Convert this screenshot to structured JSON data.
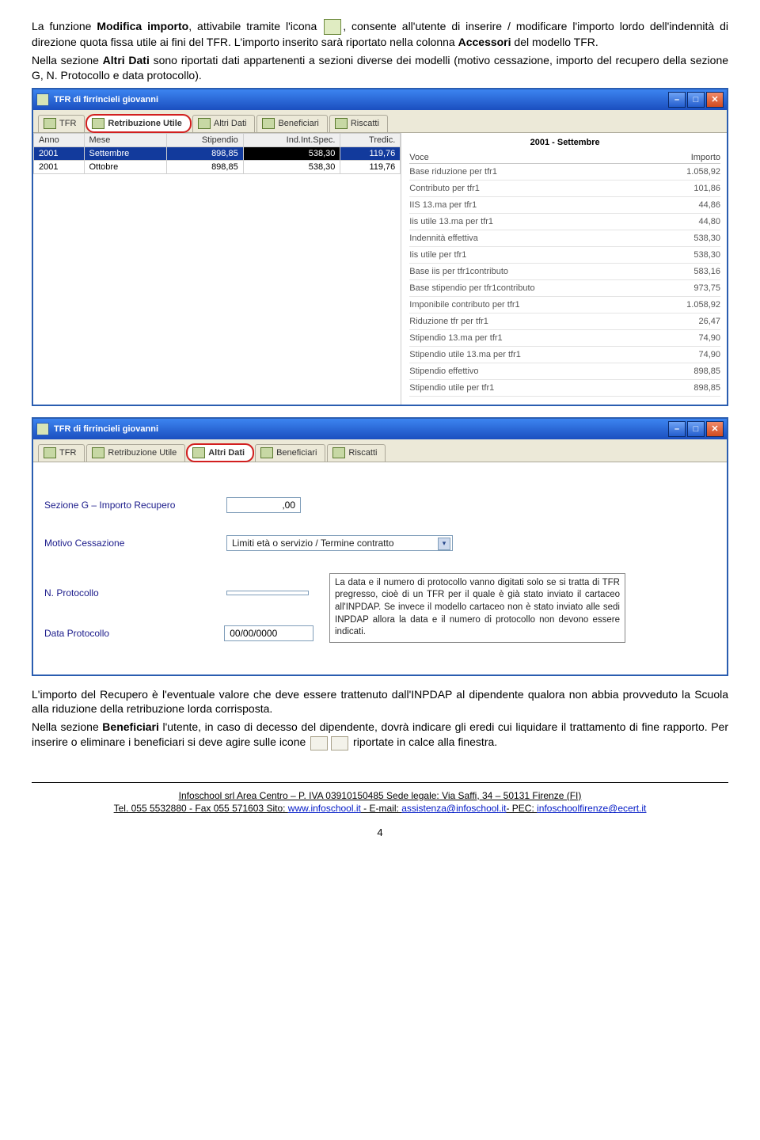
{
  "para": {
    "p1a": "La funzione ",
    "p1b": "Modifica importo",
    "p1c": ", attivabile tramite l'icona ",
    "p1d": ", consente all'utente di inserire / modificare l'importo lordo dell'indennità di direzione quota fissa utile ai fini del TFR. L'importo inserito sarà riportato nella colonna ",
    "p1e": "Accessori",
    "p1f": " del modello TFR.",
    "p2a": "Nella sezione ",
    "p2b": "Altri Dati",
    "p2c": " sono riportati dati appartenenti a sezioni diverse dei modelli (motivo cessazione, importo del recupero della sezione G, N. Protocollo e data protocollo).",
    "p3": "L'importo del Recupero è l'eventuale valore che deve essere trattenuto dall'INPDAP al dipendente qualora non abbia provveduto la Scuola alla riduzione della retribuzione lorda corrisposta.",
    "p4a": "Nella sezione ",
    "p4b": "Beneficiari",
    "p4c": " l'utente, in caso di decesso del dipendente, dovrà indicare gli eredi cui liquidare il trattamento di fine rapporto. Per inserire o eliminare i beneficiari si deve agire sulle icone ",
    "p4d": " riportate in calce alla finestra."
  },
  "win1": {
    "title": "TFR di firrincieli giovanni",
    "tabs": [
      "TFR",
      "Retribuzione Utile",
      "Altri Dati",
      "Beneficiari",
      "Riscatti"
    ],
    "grid": {
      "headers": [
        "Anno",
        "Mese",
        "Stipendio",
        "Ind.Int.Spec.",
        "Tredic."
      ],
      "rows": [
        [
          "2001",
          "Settembre",
          "898,85",
          "538,30",
          "119,76"
        ],
        [
          "2001",
          "Ottobre",
          "898,85",
          "538,30",
          "119,76"
        ]
      ]
    },
    "right": {
      "title": "2001 - Settembre",
      "col1": "Voce",
      "col2": "Importo",
      "items": [
        [
          "Base riduzione per tfr1",
          "1.058,92"
        ],
        [
          "Contributo per tfr1",
          "101,86"
        ],
        [
          "IIS 13.ma per tfr1",
          "44,86"
        ],
        [
          "Iis utile 13.ma per tfr1",
          "44,80"
        ],
        [
          "Indennità effettiva",
          "538,30"
        ],
        [
          "Iis utile per tfr1",
          "538,30"
        ],
        [
          "Base iis per tfr1contributo",
          "583,16"
        ],
        [
          "Base stipendio per tfr1contributo",
          "973,75"
        ],
        [
          "Imponibile contributo per tfr1",
          "1.058,92"
        ],
        [
          "Riduzione tfr per tfr1",
          "26,47"
        ],
        [
          "Stipendio 13.ma per tfr1",
          "74,90"
        ],
        [
          "Stipendio utile 13.ma per tfr1",
          "74,90"
        ],
        [
          "Stipendio effettivo",
          "898,85"
        ],
        [
          "Stipendio utile per tfr1",
          "898,85"
        ]
      ]
    }
  },
  "win2": {
    "title": "TFR di firrincieli giovanni",
    "tabs": [
      "TFR",
      "Retribuzione Utile",
      "Altri Dati",
      "Beneficiari",
      "Riscatti"
    ],
    "form": {
      "l_sezG": "Sezione G – Importo Recupero",
      "v_sezG": ",00",
      "l_motivo": "Motivo Cessazione",
      "v_motivo": "Limiti età o servizio / Termine contratto",
      "l_nprot": "N. Protocollo",
      "v_nprot": "",
      "l_data": "Data Protocollo",
      "v_data": "00/00/0000",
      "hint": "La data e il numero di protocollo vanno digitati solo se si tratta di TFR pregresso, cioè di un TFR per il quale è già stato inviato il cartaceo all'INPDAP. Se invece il modello cartaceo non è stato inviato alle sedi INPDAP allora la data e il numero di protocollo non devono essere indicati."
    }
  },
  "footer": {
    "line1": "Infoschool srl Area Centro – P. IVA 03910150485 Sede legale: Via Saffi, 34 – 50131 Firenze (FI)",
    "line2a": "Tel. 055 5532880 - Fax 055 571603 Sito: ",
    "site": "www.infoschool.it",
    "line2b": " - E-mail: ",
    "email": "assistenza@infoschool.it",
    "line2c": "- PEC: ",
    "pec": "infoschoolfirenze@ecert.it",
    "page": "4"
  }
}
